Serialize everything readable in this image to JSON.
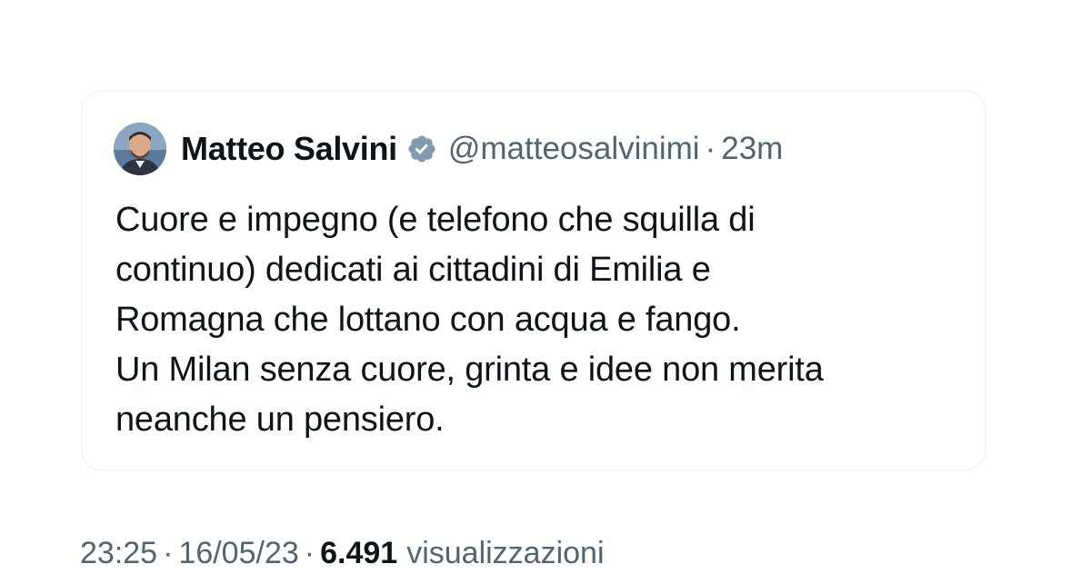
{
  "quoted_tweet": {
    "author": {
      "display_name": "Matteo Salvini",
      "handle": "@matteosalvinimi",
      "verified": true,
      "verified_icon": "verified-badge-icon",
      "verified_color": "#829aab"
    },
    "separator": "·",
    "relative_time": "23m",
    "text": "Cuore e impegno (e telefono che squilla di\ncontinuo) dedicati ai cittadini di Emilia e\nRomagna che lottano con acqua e fango.\nUn Milan senza cuore, grinta e idee non merita\nneanche un pensiero."
  },
  "tweet_meta": {
    "time": "23:25",
    "date": "16/05/23",
    "separator": "·",
    "views_count": "6.491",
    "views_label": "visualizzazioni"
  },
  "colors": {
    "text_primary": "#0f1419",
    "text_secondary": "#536471",
    "card_border": "#eff3f4"
  }
}
